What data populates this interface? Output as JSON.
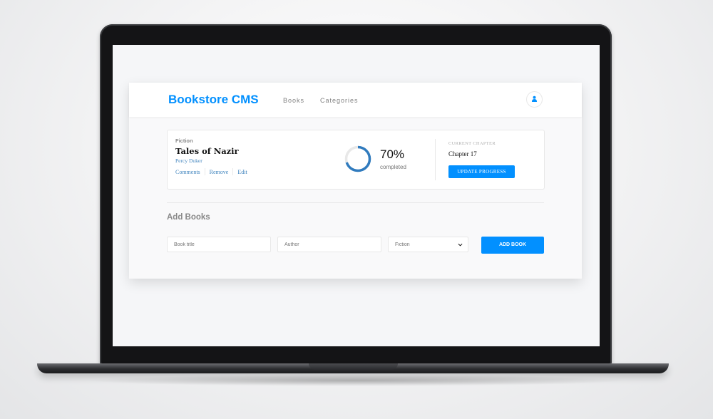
{
  "app": {
    "brand": "Bookstore CMS",
    "nav": [
      "Books",
      "Categories"
    ]
  },
  "book": {
    "category": "Fiction",
    "title": "Tales of Nazir",
    "author": "Percy Duker",
    "actions": [
      "Comments",
      "Remove",
      "Edit"
    ],
    "progress_percent": 70,
    "progress_text": "70%",
    "completed_label": "completed",
    "current_chapter_label": "CURRENT CHAPTER",
    "current_chapter": "Chapter 17",
    "update_button": "UPDATE PROGRESS"
  },
  "form": {
    "heading": "Add Books",
    "title_placeholder": "Book title",
    "author_placeholder": "Author",
    "category_selected": "Fiction",
    "submit_label": "ADD BOOK"
  },
  "colors": {
    "accent": "#0290ff",
    "link": "#4386bf",
    "ring_track": "#e8e8e8"
  },
  "icons": {
    "user": "user-icon",
    "select": "chevron-down-icon"
  }
}
